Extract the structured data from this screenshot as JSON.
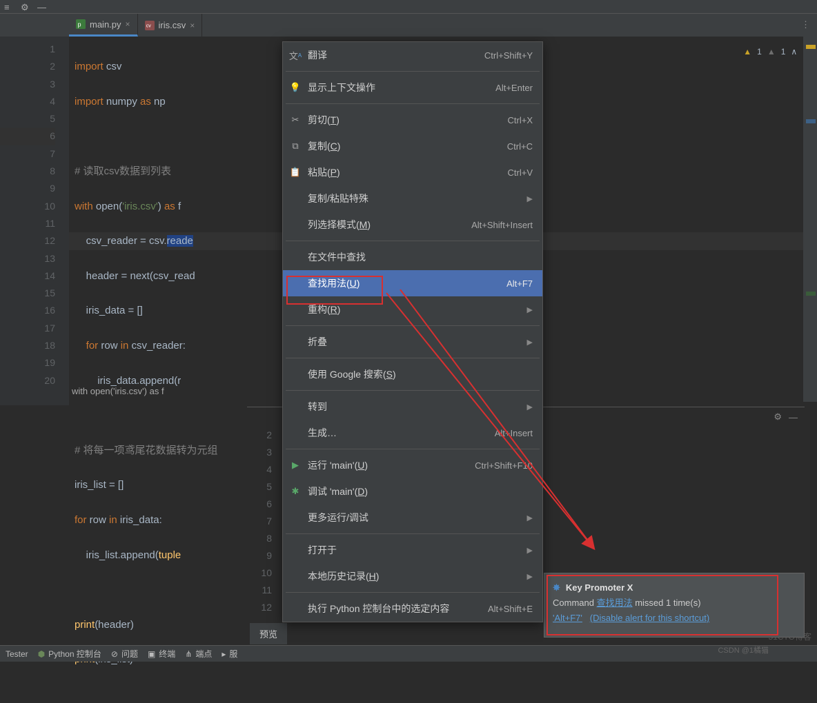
{
  "tabs": [
    {
      "name": "main.py",
      "icon": "py"
    },
    {
      "name": "iris.csv",
      "icon": "csv"
    }
  ],
  "inspections": {
    "warn": "1",
    "weak": "1"
  },
  "gutter": [
    "1",
    "2",
    "3",
    "4",
    "5",
    "6",
    "7",
    "8",
    "9",
    "10",
    "11",
    "12",
    "13",
    "14",
    "15",
    "16",
    "17",
    "18",
    "19",
    "20"
  ],
  "code": {
    "l1a": "import",
    "l1b": " csv",
    "l2a": "import",
    "l2b": " numpy ",
    "l2c": "as",
    "l2d": " np",
    "l4a": "# 读取csv数据到列表",
    "l5a": "with",
    "l5b": " open(",
    "l5c": "'iris.csv'",
    "l5d": ") ",
    "l5e": "as",
    "l5f": " f",
    "l6a": "    csv_reader = csv.",
    "l6sel": "reade",
    "l7a": "    header = next(csv_read",
    "l8a": "    iris_data = []",
    "l9a": "    ",
    "l9b": "for",
    "l9c": " row ",
    "l9d": "in",
    "l9e": " csv_reader:",
    "l10a": "        iris_data.append(r",
    "l12a": "# 将每一项鸢尾花数据转为元组",
    "l13a": "iris_list = []",
    "l14a": "for",
    "l14b": " row ",
    "l14c": "in",
    "l14d": " iris_data:",
    "l15a": "    iris_list.append(",
    "l15b": "tuple",
    "l17a": "print",
    "l17b": "(header)",
    "l18a": "print",
    "l18b": "(iris_list)"
  },
  "crumb": "with open('iris.csv') as f",
  "menu": {
    "translate": {
      "label": "翻译",
      "sc": "Ctrl+Shift+Y"
    },
    "context": {
      "label": "显示上下文操作",
      "sc": "Alt+Enter"
    },
    "cut": {
      "label": "剪切(T)",
      "sc": "Ctrl+X"
    },
    "copy": {
      "label": "复制(C)",
      "sc": "Ctrl+C"
    },
    "paste": {
      "label": "粘贴(P)",
      "sc": "Ctrl+V"
    },
    "pastesp": {
      "label": "复制/粘贴特殊"
    },
    "colsel": {
      "label": "列选择模式(M)",
      "sc": "Alt+Shift+Insert"
    },
    "findfile": {
      "label": "在文件中查找"
    },
    "findusage": {
      "label": "查找用法(U)",
      "sc": "Alt+F7"
    },
    "refactor": {
      "label": "重构(R)"
    },
    "fold": {
      "label": "折叠"
    },
    "google": {
      "label": "使用 Google 搜索(S)"
    },
    "goto": {
      "label": "转到"
    },
    "generate": {
      "label": "生成…",
      "sc": "Alt+Insert"
    },
    "run": {
      "label": "运行 'main'(U)",
      "sc": "Ctrl+Shift+F10"
    },
    "debug": {
      "label": "调试 'main'(D)"
    },
    "morerun": {
      "label": "更多运行/调试"
    },
    "openin": {
      "label": "打开于"
    },
    "localhist": {
      "label": "本地历史记录(H)"
    },
    "execsel": {
      "label": "执行 Python 控制台中的选定内容",
      "sc": "Alt+Shift+E"
    }
  },
  "bp_gutter": [
    "2",
    "3",
    "4",
    "5",
    "6",
    "7",
    "8",
    "9",
    "10",
    "11",
    "12"
  ],
  "bp_tab": "预览",
  "notif": {
    "title": "Key Promoter X",
    "l1a": "Command ",
    "l1link": "查找用法",
    "l1b": " missed 1 time(s)",
    "l2a": "'Alt+F7'",
    "l2b": "(Disable alert for this shortcut)"
  },
  "status": {
    "tester": "Tester",
    "pyconsole": "Python 控制台",
    "problems": "问题",
    "terminal": "终端",
    "endpoints": "端点",
    "services": "服"
  },
  "watermark": "51CTO博客",
  "watermark2": "CSDN @1橘猫"
}
